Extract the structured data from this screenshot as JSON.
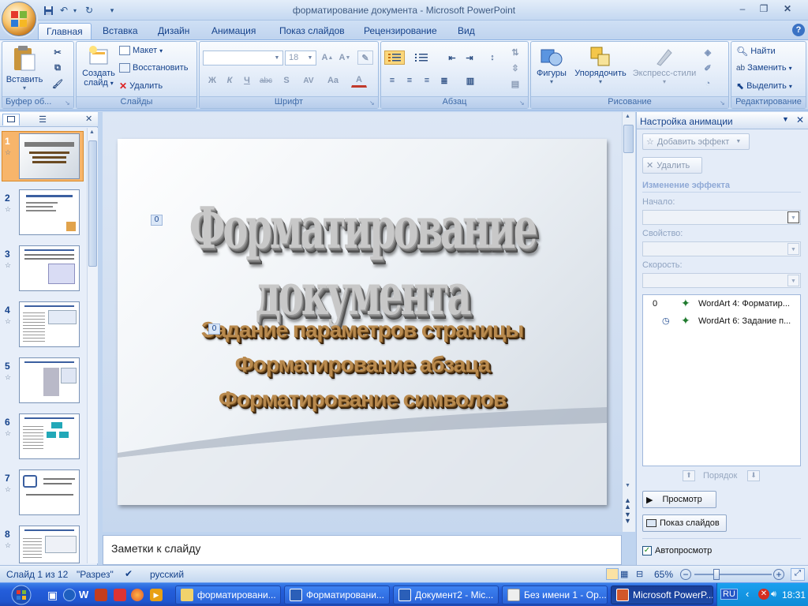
{
  "window": {
    "title": "форматирование документа - Microsoft PowerPoint"
  },
  "tabs": [
    "Главная",
    "Вставка",
    "Дизайн",
    "Анимация",
    "Показ слайдов",
    "Рецензирование",
    "Вид"
  ],
  "ribbon": {
    "clipboard": {
      "paste": "Вставить",
      "label": "Буфер об..."
    },
    "slides": {
      "new_slide": "Создать",
      "new_slide2": "слайд",
      "layout": "Макет",
      "reset": "Восстановить",
      "delete": "Удалить",
      "label": "Слайды"
    },
    "font": {
      "size": "18",
      "bold": "Ж",
      "italic": "К",
      "underline": "Ч",
      "strike": "abc",
      "shadow": "S",
      "spacing": "AV",
      "case": "Aa",
      "color": "A",
      "label": "Шрифт"
    },
    "paragraph": {
      "label": "Абзац"
    },
    "drawing": {
      "shapes": "Фигуры",
      "arrange": "Упорядочить",
      "styles": "Экспресс-стили",
      "label": "Рисование"
    },
    "editing": {
      "find": "Найти",
      "replace": "Заменить",
      "select": "Выделить",
      "label": "Редактирование"
    }
  },
  "thumbnails": [
    "1",
    "2",
    "3",
    "4",
    "5",
    "6",
    "7",
    "8"
  ],
  "slide": {
    "title": "Форматирование документа",
    "bullets": [
      "Задание параметров страницы",
      "Форматирование абзаца",
      "Форматирование символов"
    ],
    "anim_tag": "0"
  },
  "notes_placeholder": "Заметки к слайду",
  "animation_pane": {
    "title": "Настройка анимации",
    "add_effect": "Добавить эффект",
    "remove": "Удалить",
    "change_effect": "Изменение эффекта",
    "start": "Начало:",
    "property": "Свойство:",
    "speed": "Скорость:",
    "items": [
      {
        "num": "0",
        "name": "WordArt 4: Форматир..."
      },
      {
        "num": "",
        "name": "WordArt 6: Задание п..."
      }
    ],
    "order": "Порядок",
    "preview": "Просмотр",
    "slideshow": "Показ слайдов",
    "autopreview": "Автопросмотр"
  },
  "status": {
    "slide": "Слайд 1 из 12",
    "theme": "\"Разрез\"",
    "lang": "русский",
    "zoom": "65%"
  },
  "taskbar": {
    "tasks": [
      "форматировани...",
      "Форматировани...",
      "Документ2 - Mic...",
      "Без имени 1 - Op...",
      "Microsoft PowerP..."
    ],
    "lang": "RU",
    "time": "18:31"
  }
}
